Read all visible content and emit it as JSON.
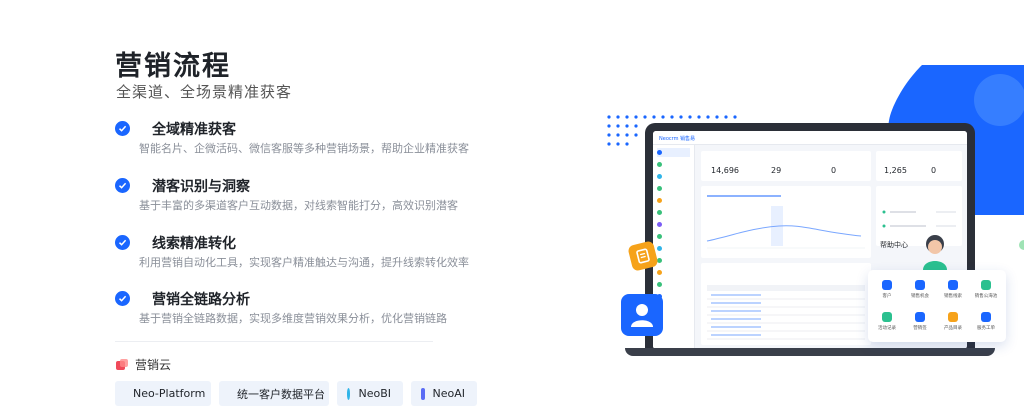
{
  "header": {
    "title": "营销流程",
    "subtitle": "全渠道、全场景精准获客"
  },
  "features": [
    {
      "title": "全域精准获客",
      "desc": "智能名片、企微活码、微信客服等多种营销场景，帮助企业精准获客"
    },
    {
      "title": "潜客识别与洞察",
      "desc": "基于丰富的多渠道客户互动数据，对线索智能打分，高效识别潜客"
    },
    {
      "title": "线索精准转化",
      "desc": "利用营销自动化工具，实现客户精准触达与沟通，提升线索转化效率"
    },
    {
      "title": "营销全链路分析",
      "desc": "基于营销全链路数据，实现多维度营销效果分析，优化营销链路"
    }
  ],
  "cloud": {
    "label": "营销云"
  },
  "products": [
    {
      "label": "Neo-Platform",
      "color": "#2bc08f"
    },
    {
      "label": "统一客户数据平台",
      "color": "#3a7bff"
    },
    {
      "label": "NeoBI",
      "color": "#2fb4e8"
    },
    {
      "label": "NeoAI",
      "color": "#5a6cf5"
    }
  ],
  "screen": {
    "brand": "Neocrm 销售易",
    "stats": [
      "14,696",
      "29",
      "0"
    ],
    "side_stat": "1,265",
    "side_stat2": "0",
    "help_title": "帮助中心",
    "help_items": [
      "客户",
      "销售机会",
      "销售线索",
      "销售公海池",
      "活动记录",
      "营销签",
      "产品目录",
      "服务工单"
    ]
  },
  "colors": {
    "accent": "#1a66ff",
    "check": "#1a66ff"
  }
}
